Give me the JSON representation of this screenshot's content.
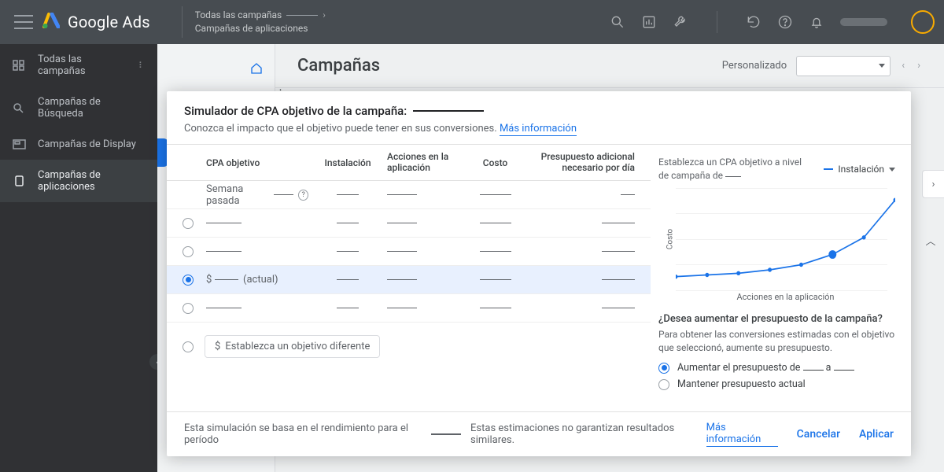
{
  "topbar": {
    "product": "Google Ads",
    "breadcrumb_root": "Todas las campañas",
    "breadcrumb_page": "Campañas de aplicaciones"
  },
  "sidebar": {
    "items": [
      {
        "label": "Todas las campañas"
      },
      {
        "label": "Campañas de Búsqueda"
      },
      {
        "label": "Campañas de Display"
      },
      {
        "label": "Campañas de aplicaciones"
      }
    ]
  },
  "page": {
    "title": "Campañas",
    "custom_label": "Personalizado"
  },
  "modal": {
    "title": "Simulador de CPA objetivo de la campaña:",
    "subtitle": "Conozca el impacto que el objetivo puede tener en sus conversiones.",
    "more_info": "Más información",
    "columns": {
      "c1": "CPA objetivo",
      "c2": "Instalación",
      "c3": "Acciones en la aplicación",
      "c4": "Costo",
      "c5": "Presupuesto adicional necesario por día"
    },
    "last_week": "Semana pasada",
    "current_label": "(actual)",
    "currency_prefix": "$",
    "set_different_target": "Establezca un objetivo diferente",
    "right": {
      "establish_prefix": "Establezca un CPA objetivo a nivel de campaña de",
      "legend_label": "Instalación",
      "xlabel": "Acciones en la aplicación",
      "ylabel": "Costo",
      "budget_q": "¿Desea aumentar el presupuesto de la campaña?",
      "budget_hint": "Para obtener las conversiones estimadas con el objetivo que seleccionó, aumente su presupuesto.",
      "opt_increase_a": "Aumentar el presupuesto de",
      "opt_increase_b": "a",
      "opt_keep": "Mantener presupuesto actual"
    },
    "footer": {
      "period_a": "Esta simulación se basa en el rendimiento para el período",
      "disclaimer": "Estas estimaciones no garantizan resultados similares.",
      "more_info": "Más información",
      "cancel": "Cancelar",
      "apply": "Aplicar"
    }
  },
  "chart_data": {
    "type": "line",
    "title": "",
    "xlabel": "Acciones en la aplicación",
    "ylabel": "Costo",
    "series": [
      {
        "name": "Instalación",
        "color": "#1a73e8",
        "x": [
          0,
          1,
          2,
          3,
          4,
          5,
          6,
          7
        ],
        "y": [
          104,
          102,
          100,
          96,
          90,
          78,
          58,
          14
        ],
        "highlight_index": 5
      }
    ],
    "xlim": [
      0,
      7
    ],
    "ylim": [
      0,
      120
    ],
    "note": "x/y are pixel-space estimates read off the plotted curve; no numeric axis ticks are shown in the image."
  }
}
